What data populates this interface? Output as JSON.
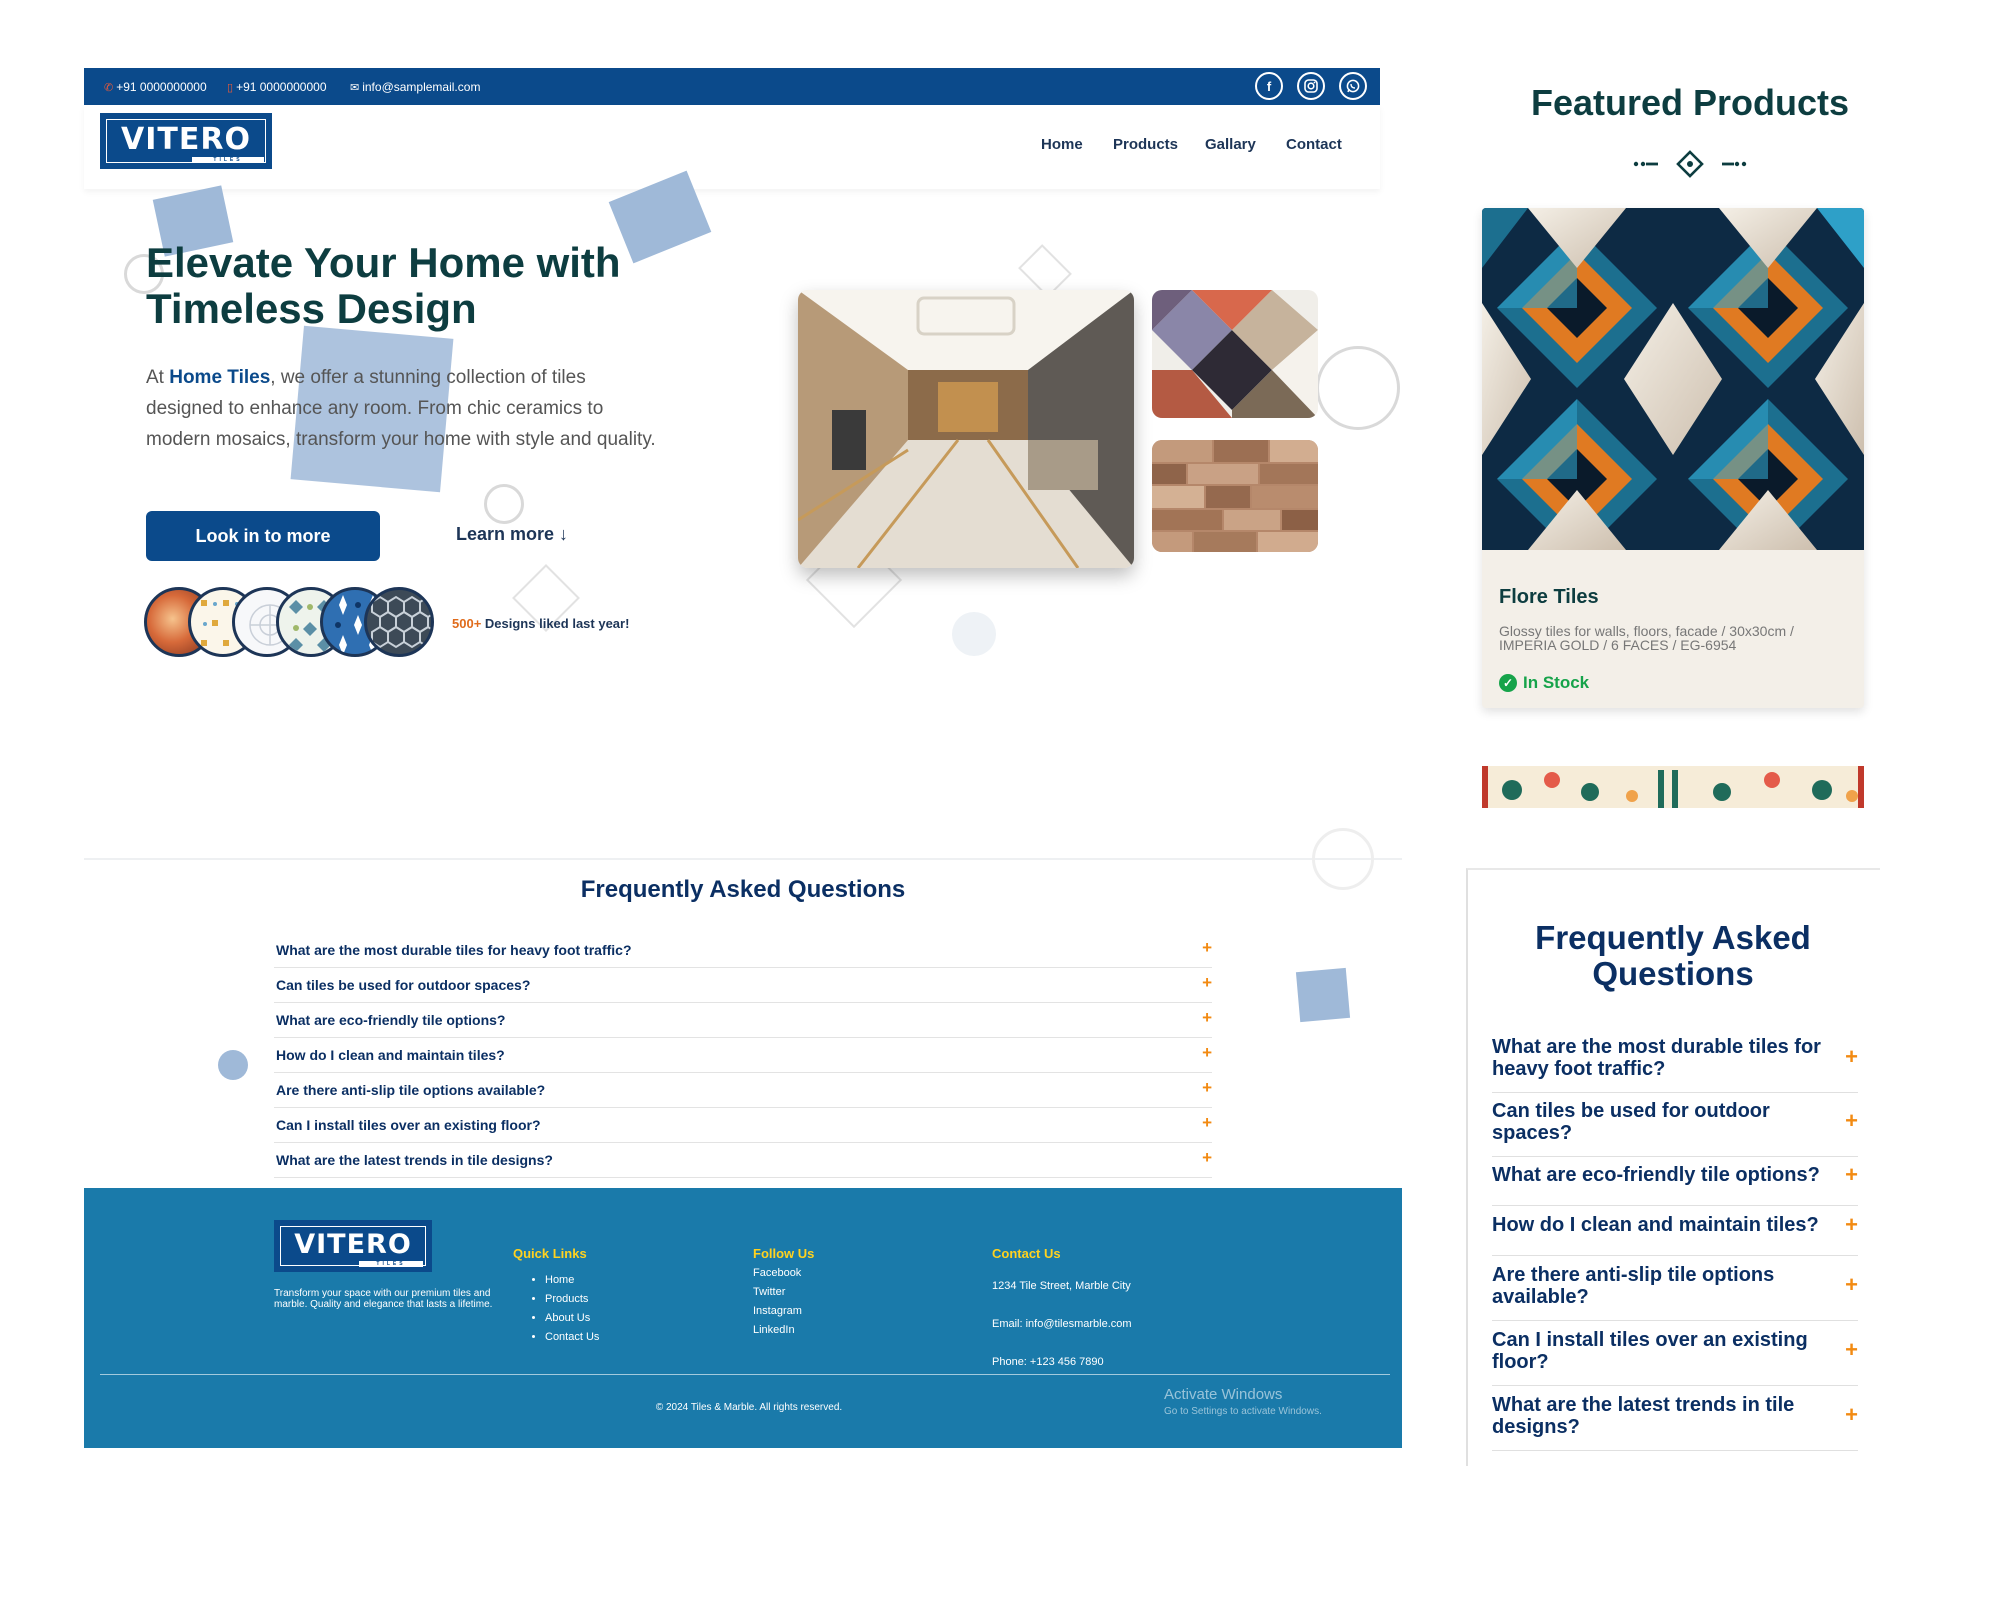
{
  "topbar": {
    "phone1": "+91 0000000000",
    "phone2": "+91 0000000000",
    "email": "info@samplemail.com",
    "social_icons": [
      "facebook-icon",
      "instagram-icon",
      "whatsapp-icon"
    ]
  },
  "brand": {
    "logo_text": "VITERO",
    "logo_sub": "TILES",
    "color_primary": "#0b4a8b",
    "color_accent": "#f28a12",
    "color_footer": "#1a7aaa"
  },
  "nav": {
    "items": [
      "Home",
      "Products",
      "Gallary",
      "Contact"
    ]
  },
  "hero": {
    "title": "Elevate Your Home with Timeless Design",
    "text_prefix": "At ",
    "text_brand": "Home Tiles",
    "text_rest": ", we offer a stunning collection of tiles designed to enhance any room. From chic ceramics to modern mosaics, transform your home with style and quality.",
    "cta_primary": "Look in to more",
    "cta_secondary": "Learn more ↓",
    "designs_count": "500+",
    "designs_text": " Designs liked last year!"
  },
  "faq": {
    "title": "Frequently Asked Questions",
    "items": [
      "What are the most durable tiles for heavy foot traffic?",
      "Can tiles be used for outdoor spaces?",
      "What are eco-friendly tile options?",
      "How do I clean and maintain tiles?",
      "Are there anti-slip tile options available?",
      "Can I install tiles over an existing floor?",
      "What are the latest trends in tile designs?"
    ],
    "expand_symbol": "+"
  },
  "footer": {
    "about": "Transform your space with our premium tiles and marble. Quality and elegance that lasts a lifetime.",
    "quick_links_title": "Quick Links",
    "quick_links": [
      "Home",
      "Products",
      "About Us",
      "Contact Us"
    ],
    "follow_title": "Follow Us",
    "follow": [
      "Facebook",
      "Twitter",
      "Instagram",
      "LinkedIn"
    ],
    "contact_title": "Contact Us",
    "address": "1234 Tile Street, Marble City",
    "email": "Email: info@tilesmarble.com",
    "phone": "Phone: +123 456 7890",
    "copyright": "© 2024 Tiles & Marble. All rights reserved.",
    "activate_title": "Activate Windows",
    "activate_sub": "Go to Settings to activate Windows."
  },
  "featured": {
    "title": "Featured Products",
    "product": {
      "name": "Flore Tiles",
      "desc": "Glossy tiles for walls, floors, facade / 30x30cm / IMPERIA GOLD / 6 FACES / EG-6954",
      "stock": "In Stock"
    }
  },
  "faq_mobile": {
    "title": "Frequently Asked Questions"
  }
}
